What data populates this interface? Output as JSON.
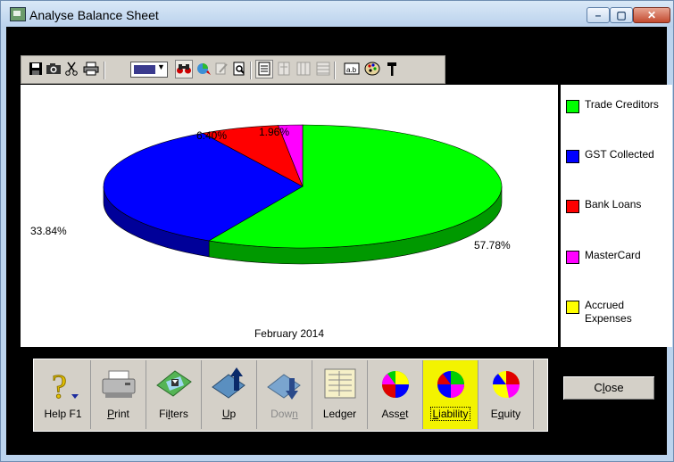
{
  "window": {
    "title": "Analyse Balance Sheet",
    "minimize_glyph": "–",
    "maximize_glyph": "▢",
    "close_glyph": "✕"
  },
  "toolbar": {
    "icons": [
      "save-icon",
      "camera-icon",
      "scissors-icon",
      "printer-icon",
      "color-select",
      "binoculars-icon",
      "tint-icon",
      "edit-icon",
      "print-preview-icon",
      "list-view-icon",
      "column-view-icon",
      "grid-view-icon",
      "table-view-icon",
      "text-label-icon",
      "palette-icon",
      "hammer-icon"
    ]
  },
  "chart": {
    "caption": "February 2014",
    "labels": {
      "trade": "57.78%",
      "gst": "33.84%",
      "bank": "6.40%",
      "master": "1.96%"
    }
  },
  "chart_data": {
    "type": "pie",
    "title": "February 2014",
    "categories": [
      "Trade Creditors",
      "GST Collected",
      "Bank Loans",
      "MasterCard",
      "Accrued Expenses"
    ],
    "values": [
      57.78,
      33.84,
      6.4,
      1.96,
      0.0
    ],
    "colors": [
      "#00ff00",
      "#0000ff",
      "#ff0000",
      "#ff00ff",
      "#ffff00"
    ],
    "legend": "right",
    "three_d": true
  },
  "legend": {
    "items": [
      {
        "label": "Trade Creditors",
        "color": "#00ff00"
      },
      {
        "label": "GST Collected",
        "color": "#0000ff"
      },
      {
        "label": "Bank Loans",
        "color": "#ff0000"
      },
      {
        "label": "MasterCard",
        "color": "#ff00ff"
      },
      {
        "label": "Accrued Expenses",
        "color": "#ffff00"
      }
    ]
  },
  "buttons": {
    "help": "Help F1",
    "print": "Print",
    "filters": "Filters",
    "up": "Up",
    "down": "Down",
    "ledger": "Ledger",
    "asset": "Asset",
    "liability": "Liability",
    "equity": "Equity",
    "close": "Close"
  }
}
